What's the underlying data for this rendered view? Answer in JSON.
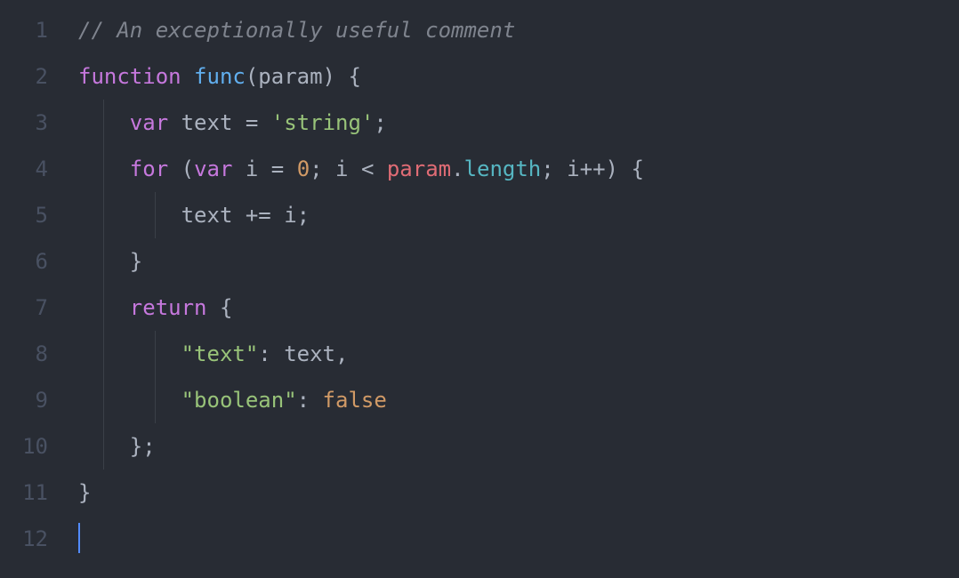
{
  "editor": {
    "lineNumbers": [
      "1",
      "2",
      "3",
      "4",
      "5",
      "6",
      "7",
      "8",
      "9",
      "10",
      "11",
      "12"
    ],
    "lines": [
      {
        "indent": 0,
        "guides": [],
        "tokens": [
          {
            "cls": "tok-comment",
            "t": "// An exceptionally useful comment"
          }
        ]
      },
      {
        "indent": 0,
        "guides": [],
        "tokens": [
          {
            "cls": "tok-keyword",
            "t": "function"
          },
          {
            "cls": "tok-default",
            "t": " "
          },
          {
            "cls": "tok-func",
            "t": "func"
          },
          {
            "cls": "tok-punct",
            "t": "("
          },
          {
            "cls": "tok-param",
            "t": "param"
          },
          {
            "cls": "tok-punct",
            "t": ")"
          },
          {
            "cls": "tok-default",
            "t": " "
          },
          {
            "cls": "tok-punct",
            "t": "{"
          }
        ]
      },
      {
        "indent": 1,
        "guides": [
          0
        ],
        "tokens": [
          {
            "cls": "tok-keyword",
            "t": "var"
          },
          {
            "cls": "tok-default",
            "t": " "
          },
          {
            "cls": "tok-ident",
            "t": "text"
          },
          {
            "cls": "tok-default",
            "t": " "
          },
          {
            "cls": "tok-oper",
            "t": "="
          },
          {
            "cls": "tok-default",
            "t": " "
          },
          {
            "cls": "tok-string",
            "t": "'string'"
          },
          {
            "cls": "tok-punct",
            "t": ";"
          }
        ]
      },
      {
        "indent": 1,
        "guides": [
          0
        ],
        "tokens": [
          {
            "cls": "tok-keyword",
            "t": "for"
          },
          {
            "cls": "tok-default",
            "t": " "
          },
          {
            "cls": "tok-punct",
            "t": "("
          },
          {
            "cls": "tok-keyword",
            "t": "var"
          },
          {
            "cls": "tok-default",
            "t": " "
          },
          {
            "cls": "tok-i",
            "t": "i"
          },
          {
            "cls": "tok-default",
            "t": " "
          },
          {
            "cls": "tok-oper",
            "t": "="
          },
          {
            "cls": "tok-default",
            "t": " "
          },
          {
            "cls": "tok-number",
            "t": "0"
          },
          {
            "cls": "tok-punct",
            "t": ";"
          },
          {
            "cls": "tok-default",
            "t": " "
          },
          {
            "cls": "tok-i",
            "t": "i"
          },
          {
            "cls": "tok-default",
            "t": " "
          },
          {
            "cls": "tok-oper",
            "t": "<"
          },
          {
            "cls": "tok-default",
            "t": " "
          },
          {
            "cls": "tok-var",
            "t": "param"
          },
          {
            "cls": "tok-punct",
            "t": "."
          },
          {
            "cls": "tok-prop",
            "t": "length"
          },
          {
            "cls": "tok-punct",
            "t": ";"
          },
          {
            "cls": "tok-default",
            "t": " "
          },
          {
            "cls": "tok-i",
            "t": "i"
          },
          {
            "cls": "tok-oper",
            "t": "++"
          },
          {
            "cls": "tok-punct",
            "t": ")"
          },
          {
            "cls": "tok-default",
            "t": " "
          },
          {
            "cls": "tok-punct",
            "t": "{"
          }
        ]
      },
      {
        "indent": 2,
        "guides": [
          0,
          1
        ],
        "tokens": [
          {
            "cls": "tok-ident",
            "t": "text"
          },
          {
            "cls": "tok-default",
            "t": " "
          },
          {
            "cls": "tok-oper",
            "t": "+="
          },
          {
            "cls": "tok-default",
            "t": " "
          },
          {
            "cls": "tok-i",
            "t": "i"
          },
          {
            "cls": "tok-punct",
            "t": ";"
          }
        ]
      },
      {
        "indent": 1,
        "guides": [
          0
        ],
        "tokens": [
          {
            "cls": "tok-punct",
            "t": "}"
          }
        ]
      },
      {
        "indent": 1,
        "guides": [
          0
        ],
        "tokens": [
          {
            "cls": "tok-keyword",
            "t": "return"
          },
          {
            "cls": "tok-default",
            "t": " "
          },
          {
            "cls": "tok-punct",
            "t": "{"
          }
        ]
      },
      {
        "indent": 2,
        "guides": [
          0,
          1
        ],
        "tokens": [
          {
            "cls": "tok-string",
            "t": "\"text\""
          },
          {
            "cls": "tok-punct",
            "t": ":"
          },
          {
            "cls": "tok-default",
            "t": " "
          },
          {
            "cls": "tok-ident",
            "t": "text"
          },
          {
            "cls": "tok-punct",
            "t": ","
          }
        ]
      },
      {
        "indent": 2,
        "guides": [
          0,
          1
        ],
        "tokens": [
          {
            "cls": "tok-string",
            "t": "\"boolean\""
          },
          {
            "cls": "tok-punct",
            "t": ":"
          },
          {
            "cls": "tok-default",
            "t": " "
          },
          {
            "cls": "tok-const",
            "t": "false"
          }
        ]
      },
      {
        "indent": 1,
        "guides": [
          0
        ],
        "tokens": [
          {
            "cls": "tok-punct",
            "t": "}"
          },
          {
            "cls": "tok-punct",
            "t": ";"
          }
        ]
      },
      {
        "indent": 0,
        "guides": [],
        "tokens": [
          {
            "cls": "tok-punct",
            "t": "}"
          }
        ]
      },
      {
        "indent": 0,
        "guides": [],
        "cursor": true,
        "tokens": []
      }
    ]
  },
  "theme": {
    "background": "#282c34",
    "gutterColor": "#495162",
    "indentGuide": "#3b4048",
    "cursor": "#528bff",
    "colors": {
      "comment": "#7f848e",
      "keyword": "#c678dd",
      "function": "#61afef",
      "variable": "#e06c75",
      "string": "#98c379",
      "number": "#d19a66",
      "constant": "#d19a66",
      "property": "#56b6c2",
      "default": "#abb2bf"
    }
  }
}
